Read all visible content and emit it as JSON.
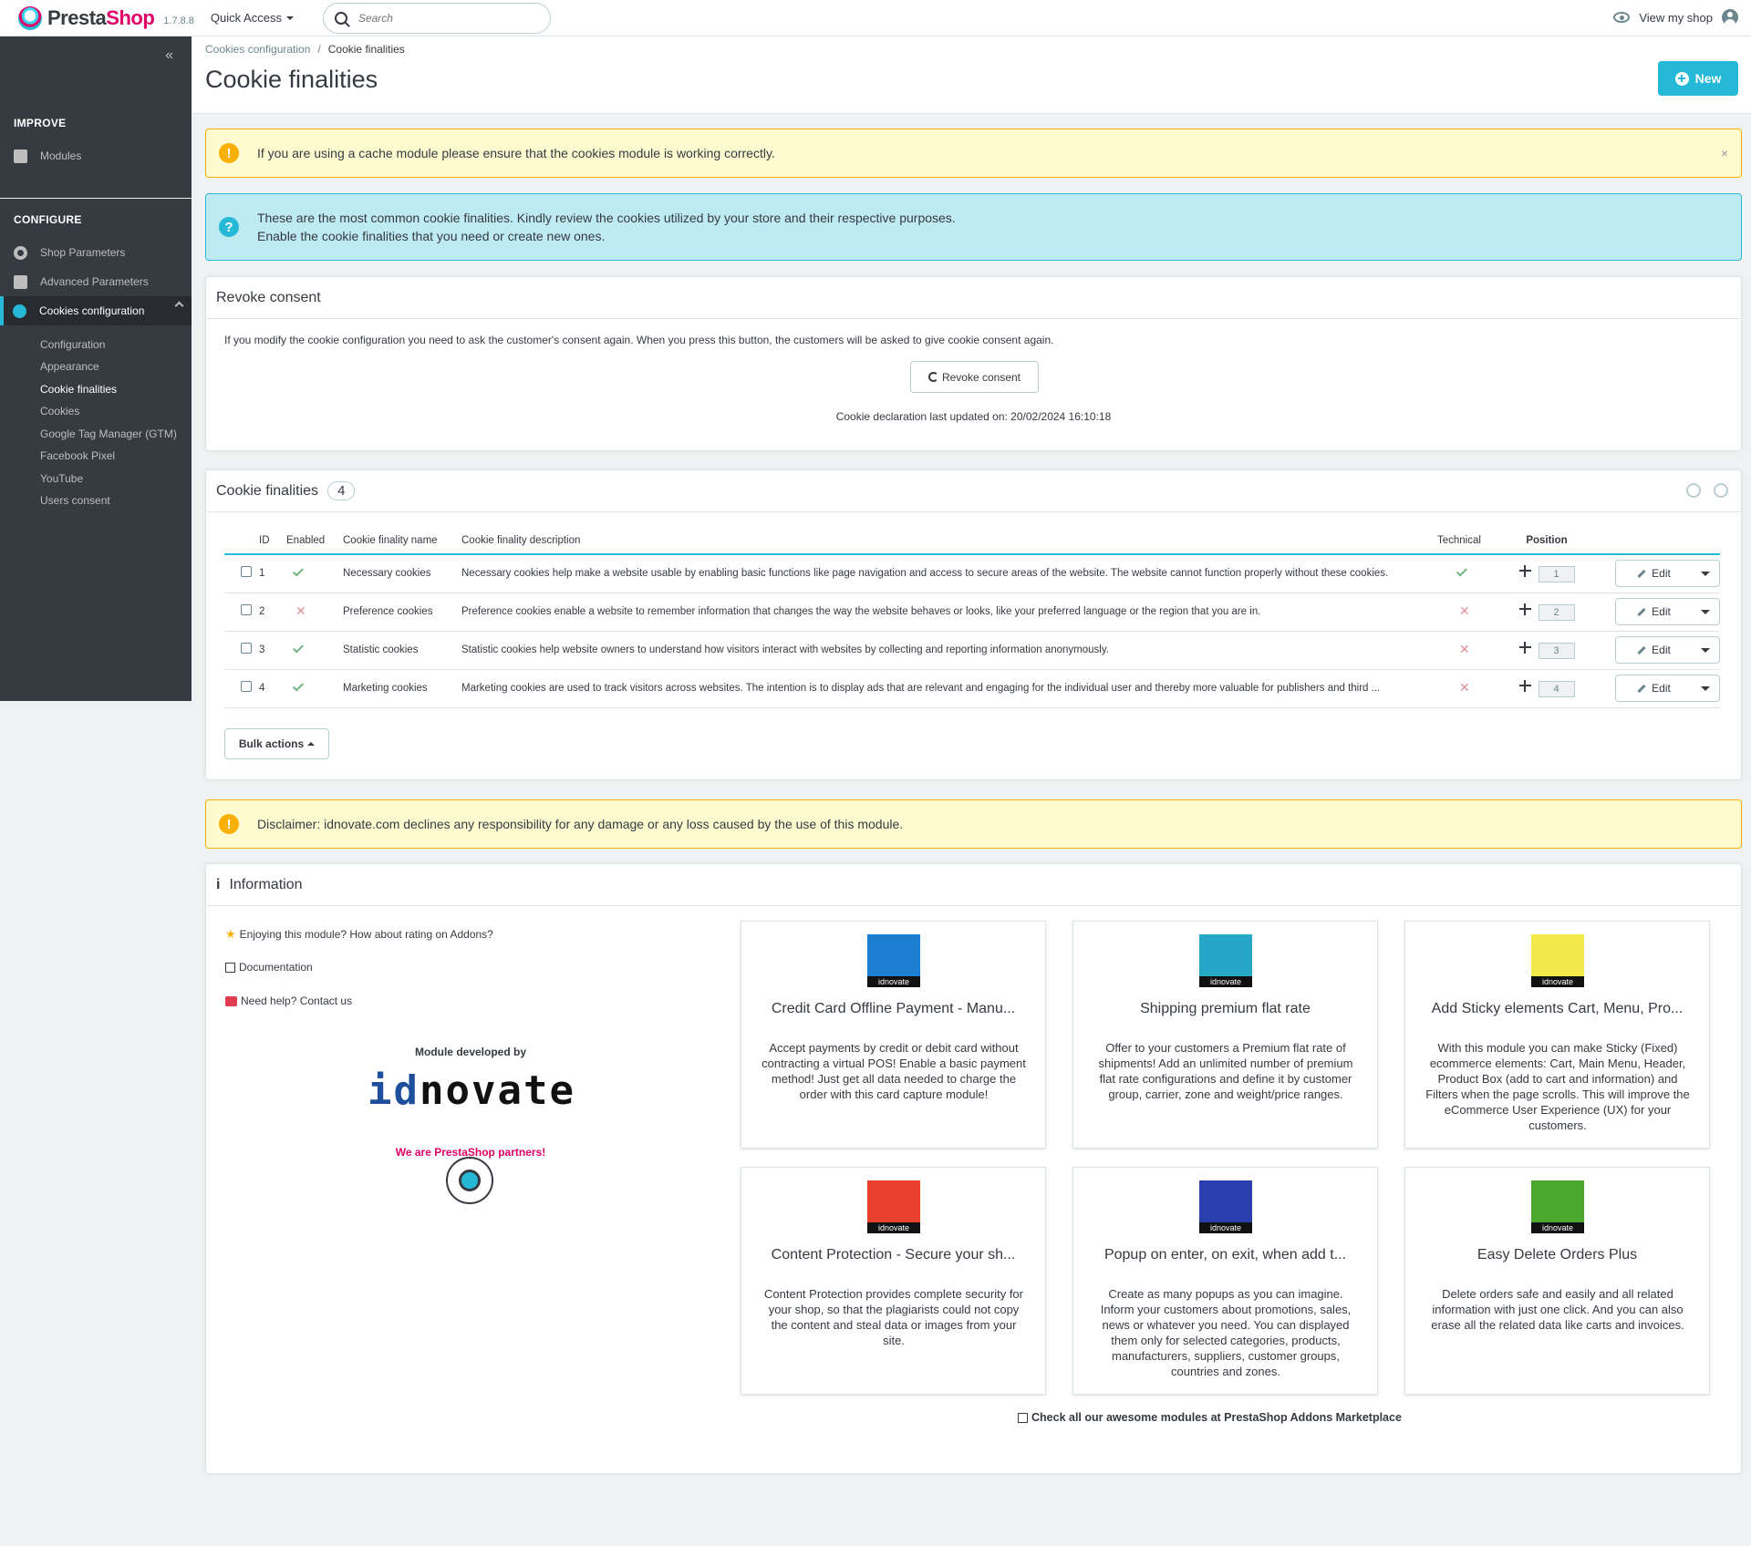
{
  "header": {
    "logo_text_a": "Presta",
    "logo_text_b": "Shop",
    "version": "1.7.8.8",
    "quick_access": "Quick Access",
    "search_placeholder": "Search",
    "view_shop": "View my shop"
  },
  "sidebar": {
    "collapse": "«",
    "improve_heading": "IMPROVE",
    "modules": "Modules",
    "configure_heading": "CONFIGURE",
    "shop_parameters": "Shop Parameters",
    "advanced_parameters": "Advanced Parameters",
    "cookies_configuration": "Cookies configuration",
    "submenu": [
      "Configuration",
      "Appearance",
      "Cookie finalities",
      "Cookies",
      "Google Tag Manager (GTM)",
      "Facebook Pixel",
      "YouTube",
      "Users consent"
    ]
  },
  "page": {
    "breadcrumb_parent": "Cookies configuration",
    "breadcrumb_sep": "/",
    "breadcrumb_current": "Cookie finalities",
    "title": "Cookie finalities",
    "new_button": "New"
  },
  "alerts": {
    "cache_warning": "If you are using a cache module please ensure that the cookies module is working correctly.",
    "close": "×",
    "info_line1": "These are the most common cookie finalities. Kindly review the cookies utilized by your store and their respective purposes.",
    "info_line2": "Enable the cookie finalities that you need or create new ones.",
    "disclaimer": "Disclaimer: idnovate.com declines any responsibility for any damage or any loss caused by the use of this module."
  },
  "revoke": {
    "title": "Revoke consent",
    "description": "If you modify the cookie configuration you need to ask the customer's consent again. When you press this button, the customers will be asked to give cookie consent again.",
    "button": "Revoke consent",
    "last_updated": "Cookie declaration last updated on: 20/02/2024 16:10:18"
  },
  "finalities": {
    "title": "Cookie finalities",
    "count": "4",
    "columns": {
      "id": "ID",
      "enabled": "Enabled",
      "name": "Cookie finality name",
      "description": "Cookie finality description",
      "technical": "Technical",
      "position": "Position"
    },
    "rows": [
      {
        "id": "1",
        "enabled": true,
        "name": "Necessary cookies",
        "description": "Necessary cookies help make a website usable by enabling basic functions like page navigation and access to secure areas of the website. The website cannot function properly without these cookies.",
        "technical": true,
        "position": "1",
        "edit": "Edit"
      },
      {
        "id": "2",
        "enabled": false,
        "name": "Preference cookies",
        "description": "Preference cookies enable a website to remember information that changes the way the website behaves or looks, like your preferred language or the region that you are in.",
        "technical": false,
        "position": "2",
        "edit": "Edit"
      },
      {
        "id": "3",
        "enabled": true,
        "name": "Statistic cookies",
        "description": "Statistic cookies help website owners to understand how visitors interact with websites by collecting and reporting information anonymously.",
        "technical": false,
        "position": "3",
        "edit": "Edit"
      },
      {
        "id": "4",
        "enabled": true,
        "name": "Marketing cookies",
        "description": "Marketing cookies are used to track visitors across websites. The intention is to display ads that are relevant and engaging for the individual user and thereby more valuable for publishers and third ...",
        "technical": false,
        "position": "4",
        "edit": "Edit"
      }
    ],
    "bulk_actions": "Bulk actions"
  },
  "information": {
    "title": "Information",
    "rating_link": "Enjoying this module? How about rating on Addons?",
    "documentation_link": "Documentation",
    "help_link": "Need help? Contact us",
    "developed_by": "Module developed by",
    "brand_a": "id",
    "brand_b": "novate",
    "partners": "We are PrestaShop partners!",
    "marketplace_link": "Check all our awesome modules at PrestaShop Addons Marketplace",
    "cards": [
      {
        "title": "Credit Card Offline Payment - Manu...",
        "description": "Accept payments by credit or debit card without contracting a virtual POS! Enable a basic payment method! Just get all data needed to charge the order with this card capture module!",
        "tag": "idnovate",
        "color": "#1d7fd1"
      },
      {
        "title": "Shipping premium flat rate",
        "description": "Offer to your customers a Premium flat rate of shipments! Add an unlimited number of premium flat rate configurations and define it by customer group, carrier, zone and weight/price ranges.",
        "tag": "idnovate",
        "color": "#27a7c7"
      },
      {
        "title": "Add Sticky elements Cart, Menu, Pro...",
        "description": "With this module you can make Sticky (Fixed) ecommerce elements: Cart, Main Menu, Header, Product Box (add to cart and information) and Filters when the page scrolls. This will improve the eCommerce User Experience (UX) for your customers.",
        "tag": "idnovate",
        "color": "#f2e94b"
      },
      {
        "title": "Content Protection - Secure your sh...",
        "description": "Content Protection provides complete security for your shop, so that the plagiarists could not copy the content and steal data or images from your site.",
        "tag": "idnovate",
        "color": "#e8412c"
      },
      {
        "title": "Popup on enter, on exit, when add t...",
        "description": "Create as many popups as you can imagine. Inform your customers about promotions, sales, news or whatever you need. You can displayed them only for selected categories, products, manufacturers, suppliers, customer groups, countries and zones.",
        "tag": "idnovate",
        "color": "#2a3fae"
      },
      {
        "title": "Easy Delete Orders Plus",
        "description": "Delete orders safe and easily and all related information with just one click. And you can also erase all the related data like carts and invoices.",
        "tag": "idnovate",
        "color": "#4aa82c"
      }
    ]
  }
}
